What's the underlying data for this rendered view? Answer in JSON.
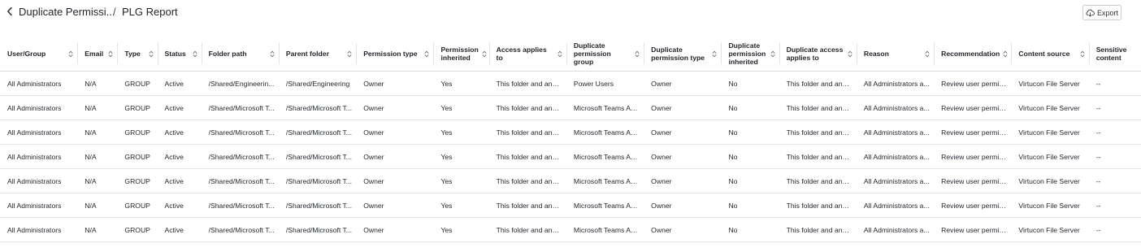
{
  "header": {
    "breadcrumb_1": "Duplicate Permissi...",
    "separator": "/",
    "breadcrumb_2": "PLG Report",
    "export_label": "Export"
  },
  "table": {
    "columns": [
      {
        "label": "User/Group",
        "sortable": true
      },
      {
        "label": "Email",
        "sortable": true
      },
      {
        "label": "Type",
        "sortable": true
      },
      {
        "label": "Status",
        "sortable": true
      },
      {
        "label": "Folder path",
        "sortable": true
      },
      {
        "label": "Parent folder",
        "sortable": true
      },
      {
        "label": "Permission type",
        "sortable": true
      },
      {
        "label": "Permission inherited",
        "sortable": true
      },
      {
        "label": "Access applies to",
        "sortable": true
      },
      {
        "label": "Duplicate permission group",
        "sortable": true
      },
      {
        "label": "Duplicate permission type",
        "sortable": true
      },
      {
        "label": "Duplicate permission inherited",
        "sortable": true
      },
      {
        "label": "Duplicate access applies to",
        "sortable": true
      },
      {
        "label": "Reason",
        "sortable": true
      },
      {
        "label": "Recommendation",
        "sortable": true
      },
      {
        "label": "Content source",
        "sortable": true
      },
      {
        "label": "Sensitive content",
        "sortable": false
      }
    ],
    "rows": [
      [
        "All Administrators",
        "N/A",
        "GROUP",
        "Active",
        "/Shared/Engineerin...",
        "/Shared/Engineering",
        "Owner",
        "Yes",
        "This folder and any ...",
        "Power Users",
        "Owner",
        "No",
        "This folder and any ...",
        "All Administrators a...",
        "Review user permis...",
        "Virtucon File Server",
        "--"
      ],
      [
        "All Administrators",
        "N/A",
        "GROUP",
        "Active",
        "/Shared/Microsoft T...",
        "/Shared/Microsoft T...",
        "Owner",
        "Yes",
        "This folder and any ...",
        "Microsoft Teams Ad...",
        "Owner",
        "No",
        "This folder and any ...",
        "All Administrators a...",
        "Review user permis...",
        "Virtucon File Server",
        "--"
      ],
      [
        "All Administrators",
        "N/A",
        "GROUP",
        "Active",
        "/Shared/Microsoft T...",
        "/Shared/Microsoft T...",
        "Owner",
        "Yes",
        "This folder and any ...",
        "Microsoft Teams Ad...",
        "Owner",
        "No",
        "This folder and any ...",
        "All Administrators a...",
        "Review user permis...",
        "Virtucon File Server",
        "--"
      ],
      [
        "All Administrators",
        "N/A",
        "GROUP",
        "Active",
        "/Shared/Microsoft T...",
        "/Shared/Microsoft T...",
        "Owner",
        "Yes",
        "This folder and any ...",
        "Microsoft Teams Ad...",
        "Owner",
        "No",
        "This folder and any ...",
        "All Administrators a...",
        "Review user permis...",
        "Virtucon File Server",
        "--"
      ],
      [
        "All Administrators",
        "N/A",
        "GROUP",
        "Active",
        "/Shared/Microsoft T...",
        "/Shared/Microsoft T...",
        "Owner",
        "Yes",
        "This folder and any ...",
        "Microsoft Teams Ad...",
        "Owner",
        "No",
        "This folder and any ...",
        "All Administrators a...",
        "Review user permis...",
        "Virtucon File Server",
        "--"
      ],
      [
        "All Administrators",
        "N/A",
        "GROUP",
        "Active",
        "/Shared/Microsoft T...",
        "/Shared/Microsoft T...",
        "Owner",
        "Yes",
        "This folder and any ...",
        "Microsoft Teams Ad...",
        "Owner",
        "No",
        "This folder and any ...",
        "All Administrators a...",
        "Review user permis...",
        "Virtucon File Server",
        "--"
      ],
      [
        "All Administrators",
        "N/A",
        "GROUP",
        "Active",
        "/Shared/Microsoft T...",
        "/Shared/Microsoft T...",
        "Owner",
        "Yes",
        "This folder and any ...",
        "Microsoft Teams Ad...",
        "Owner",
        "No",
        "This folder and any ...",
        "All Administrators a...",
        "Review user permis...",
        "Virtucon File Server",
        "--"
      ]
    ]
  },
  "icons": {
    "back": "chevron-left-icon",
    "export": "cloud-download-icon",
    "sort": "sort-icon"
  }
}
